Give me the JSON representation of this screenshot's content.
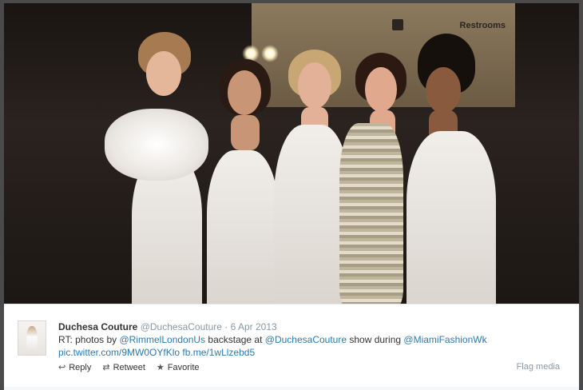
{
  "photo": {
    "sign_text": "Restrooms",
    "fb_icon": "facebook-icon"
  },
  "tweet": {
    "author_name": "Duchesa Couture",
    "author_handle": "@DuchesaCouture",
    "separator": "·",
    "date": "6 Apr 2013",
    "text_parts": {
      "prefix": "RT: photos by ",
      "mention1": "@RimmelLondonUs",
      "middle": " backstage at ",
      "mention2": "@DuchesaCouture",
      "middle2": " show during ",
      "mention3": "@MiamiFashionWk",
      "link1": "pic.twitter.com/9MW0OYfKlo",
      "link2": "fb.me/1wLlzebd5"
    },
    "actions": {
      "reply_label": "Reply",
      "reply_icon": "reply-icon",
      "retweet_label": "Retweet",
      "retweet_icon": "retweet-icon",
      "favorite_label": "Favorite",
      "favorite_icon": "star-icon"
    },
    "flag_label": "Flag media"
  },
  "colors": {
    "link": "#2a7ab0",
    "meta": "#8899a6",
    "text": "#333333"
  }
}
